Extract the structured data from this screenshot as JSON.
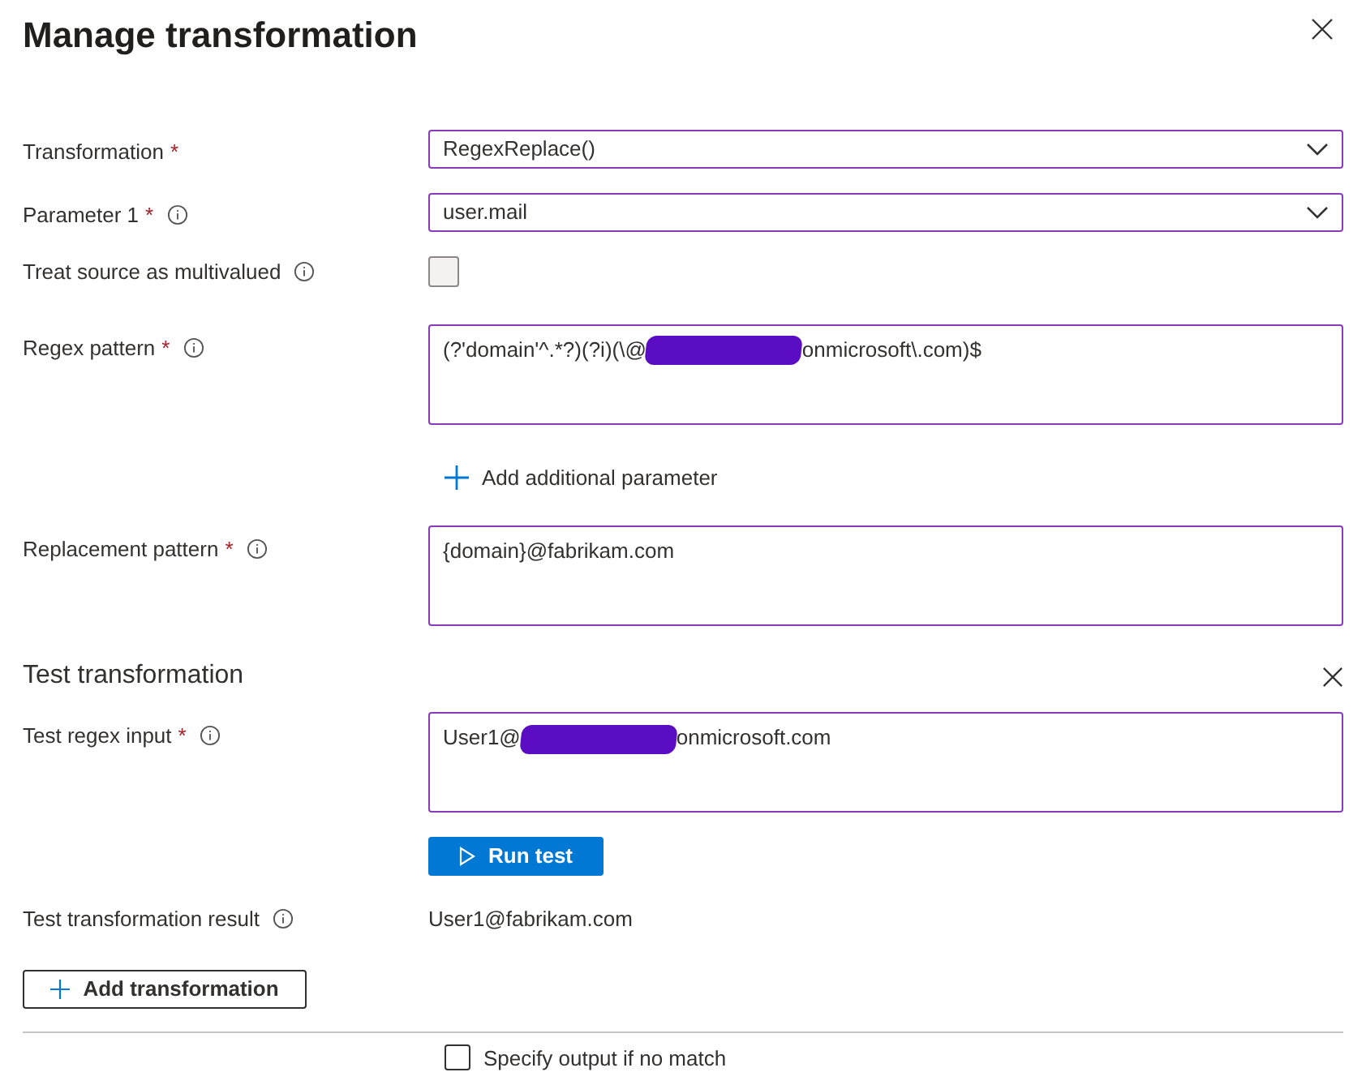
{
  "title": "Manage transformation",
  "fields": [
    {
      "kind": "select",
      "label": "Transformation",
      "required_mark": "*",
      "info": false,
      "value": "RegexReplace()"
    },
    {
      "kind": "select",
      "label": "Parameter 1",
      "required_mark": "*",
      "info": true,
      "value": "user.mail"
    },
    {
      "kind": "checkbox",
      "label": "Treat source as multivalued",
      "info": true,
      "checked": false
    },
    {
      "kind": "textarea",
      "label": "Regex pattern",
      "required_mark": "*",
      "info": true,
      "value_before": "(?'domain'^.*?)(?i)(\\@",
      "redacted": true,
      "value_after": "onmicrosoft\\.com)$"
    },
    {
      "kind": "link",
      "label": "Add additional parameter"
    },
    {
      "kind": "textarea",
      "label": "Replacement pattern",
      "required_mark": "*",
      "info": true,
      "value_before": "{domain}@fabrikam.com"
    }
  ],
  "test": {
    "heading": "Test transformation",
    "input_label": "Test regex input",
    "input_required_mark": "*",
    "input_before": "User1@",
    "input_redacted": true,
    "input_after": "onmicrosoft.com",
    "run_button": "Run test",
    "result_label": "Test transformation result",
    "result_value": "User1@fabrikam.com"
  },
  "add_button": "Add transformation",
  "no_match": {
    "label": "Specify output if no match",
    "checked": false
  }
}
